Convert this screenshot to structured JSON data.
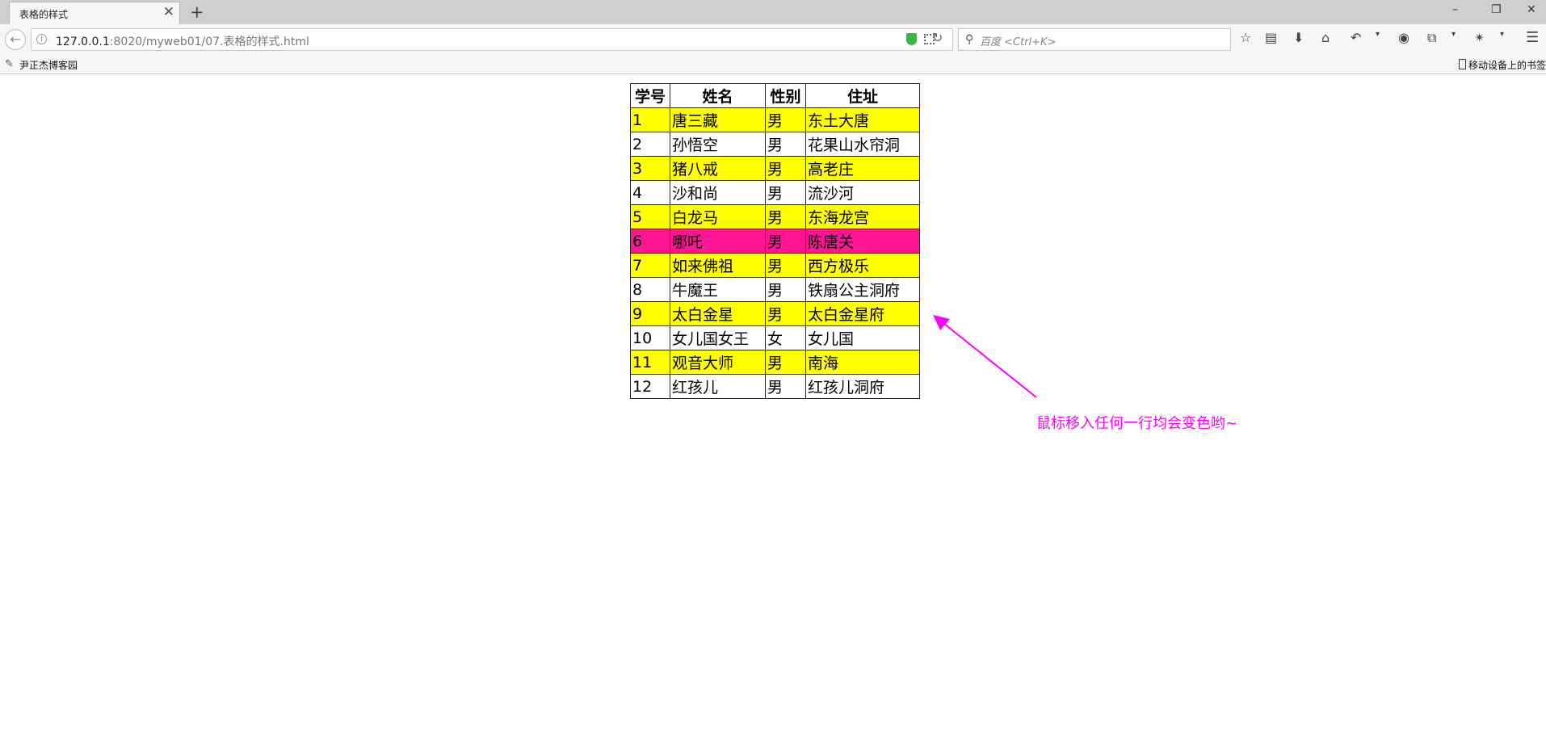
{
  "tab": {
    "title": "表格的样式",
    "close": "✕",
    "new": "+"
  },
  "window": {
    "minimize": "–",
    "restore": "❐",
    "close": "✕"
  },
  "nav": {
    "url_host": "127.0.0.1",
    "url_path": ":8020/myweb01/07.表格的样式.html",
    "search_placeholder": "百度 <Ctrl+K>"
  },
  "bookmarks": {
    "item": "尹正杰博客园",
    "mobile": "移动设备上的书签"
  },
  "table": {
    "headers": [
      "学号",
      "姓名",
      "性别",
      "住址"
    ],
    "rows": [
      [
        "1",
        "唐三藏",
        "男",
        "东土大唐"
      ],
      [
        "2",
        "孙悟空",
        "男",
        "花果山水帘洞"
      ],
      [
        "3",
        "猪八戒",
        "男",
        "高老庄"
      ],
      [
        "4",
        "沙和尚",
        "男",
        "流沙河"
      ],
      [
        "5",
        "白龙马",
        "男",
        "东海龙宫"
      ],
      [
        "6",
        "哪吒",
        "男",
        "陈唐关"
      ],
      [
        "7",
        "如来佛祖",
        "男",
        "西方极乐"
      ],
      [
        "8",
        "牛魔王",
        "男",
        "铁扇公主洞府"
      ],
      [
        "9",
        "太白金星",
        "男",
        "太白金星府"
      ],
      [
        "10",
        "女儿国女王",
        "女",
        "女儿国"
      ],
      [
        "11",
        "观音大师",
        "男",
        "南海"
      ],
      [
        "12",
        "红孩儿",
        "男",
        "红孩儿洞府"
      ]
    ],
    "odd_row_color": "#ffff00",
    "even_row_color": "#ffffff",
    "hover_row_color": "#ff1493",
    "hovered_row": 6
  },
  "annotation": {
    "text": "鼠标移入任何一行均会变色哟~",
    "color": "#ff00ff"
  }
}
